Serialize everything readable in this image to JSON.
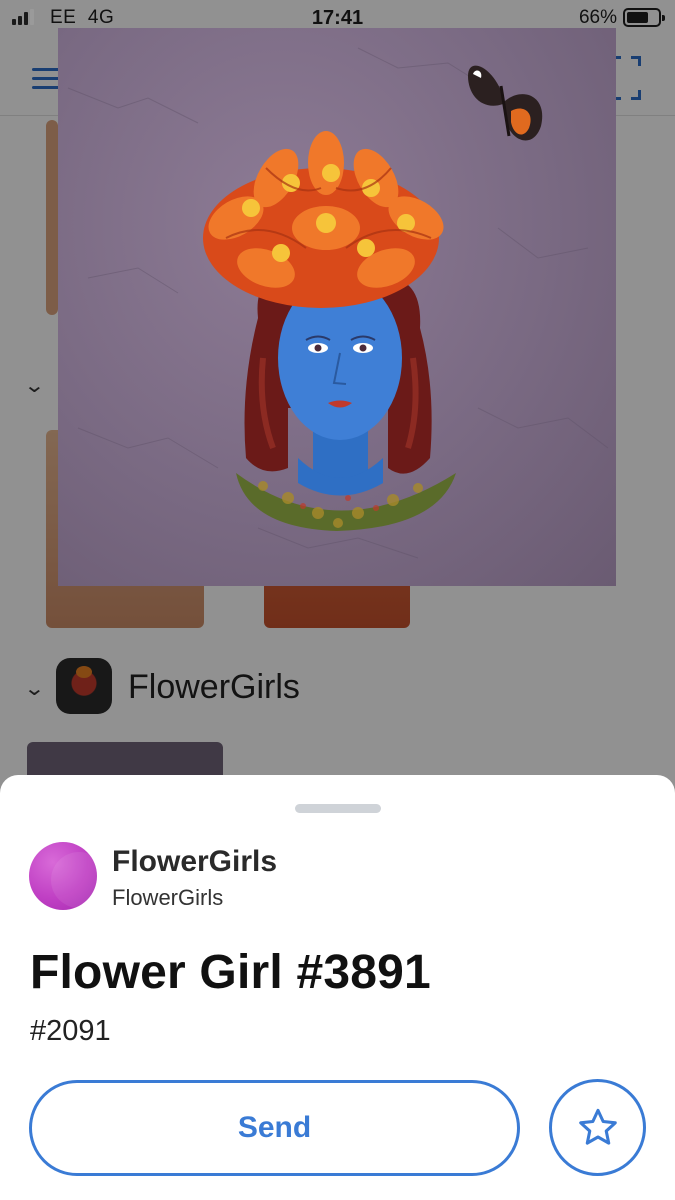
{
  "status_bar": {
    "carrier": "EE",
    "network": "4G",
    "time": "17:41",
    "battery_percent": "66%",
    "battery_level": 0.66
  },
  "background": {
    "menu_icon": "hamburger-menu-icon",
    "scan_icon": "scan-qr-icon",
    "collection_row_label": "FlowerGirls"
  },
  "artwork": {
    "description_icon": "flower-girl-artwork",
    "background_color": "#7a6a83"
  },
  "sheet": {
    "collection_name": "FlowerGirls",
    "collection_subtitle": "FlowerGirls",
    "nft_title": "Flower Girl #3891",
    "nft_number": "#2091",
    "send_label": "Send",
    "favorite_icon": "star-icon"
  },
  "colors": {
    "accent": "#3a7bd5",
    "avatar": "#c040c4"
  }
}
